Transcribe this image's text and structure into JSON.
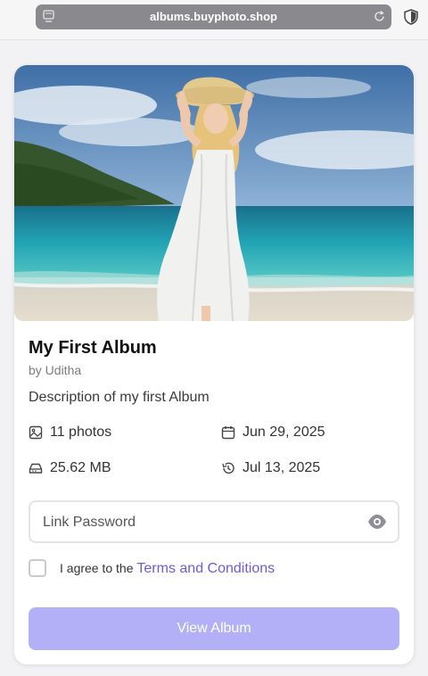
{
  "browser": {
    "url": "albums.buyphoto.shop",
    "icons": [
      "tabs-icon",
      "reload-icon",
      "shield-icon"
    ]
  },
  "album": {
    "title": "My First Album",
    "author": "by Uditha",
    "description": "Description of my first Album",
    "photos": "11 photos",
    "date_created": "Jun 29, 2025",
    "size": "25.62 MB",
    "date_updated": "Jul 13, 2025",
    "cover_icon": "photo-of-woman-on-beach"
  },
  "form": {
    "password_placeholder": "Link Password",
    "agree_text": "I agree to the ",
    "terms_link": "Terms and Conditions",
    "view_button": "View Album"
  },
  "colors": {
    "accent": "#6f5cd6",
    "button_disabled": "#b3b0f7"
  }
}
